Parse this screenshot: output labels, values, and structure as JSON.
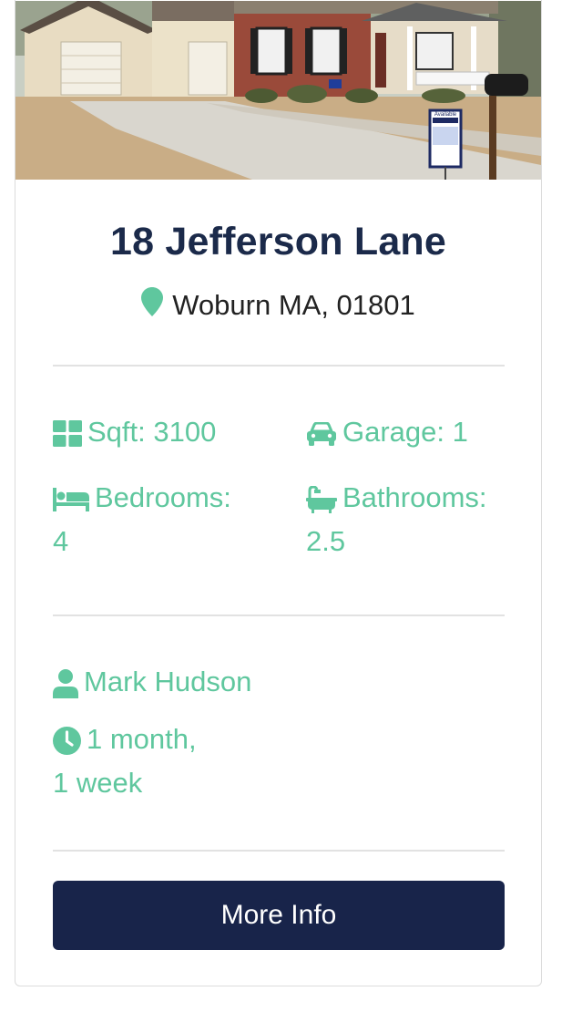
{
  "listing": {
    "title": "18 Jefferson Lane",
    "address": "Woburn MA, 01801",
    "sqft": "Sqft: 3100",
    "garage": "Garage: 1",
    "bedrooms_label": "Bedrooms:",
    "bedrooms_value": "4",
    "bathrooms_label": "Bathrooms:",
    "bathrooms_value": "2.5",
    "agent": "Mark Hudson",
    "listed_line1": "1 month,",
    "listed_line2": "1 week",
    "sign_text": "Available"
  },
  "button": {
    "label": "More Info"
  },
  "icons": {
    "location": "map-marker-icon",
    "sqft": "grid-icon",
    "garage": "car-icon",
    "bedrooms": "bed-icon",
    "bathrooms": "bath-icon",
    "agent": "user-icon",
    "listed": "clock-icon"
  },
  "colors": {
    "accent": "#5fc79e",
    "title": "#1b2a4a",
    "button_bg": "#18244a",
    "button_text": "#ffffff"
  }
}
